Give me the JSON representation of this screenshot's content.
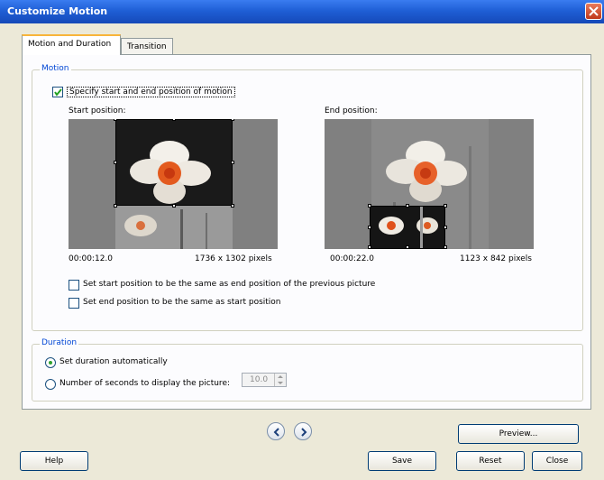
{
  "window": {
    "title": "Customize Motion"
  },
  "tabs": [
    {
      "label": "Motion and Duration"
    },
    {
      "label": "Transition"
    }
  ],
  "motion": {
    "group_label": "Motion",
    "specify_checkbox_label": "Specify start and end position of motion",
    "specify_checked": true,
    "start": {
      "label": "Start position:",
      "time": "00:00:12.0",
      "size": "1736 x 1302 pixels"
    },
    "end": {
      "label": "End position:",
      "time": "00:00:22.0",
      "size": "1123 x 842 pixels"
    },
    "same_as_prev_label": "Set start position to be the same as end position of the previous picture",
    "same_as_prev_checked": false,
    "same_as_start_label": "Set end position to be the same as start position",
    "same_as_start_checked": false
  },
  "duration": {
    "group_label": "Duration",
    "auto_label": "Set duration automatically",
    "auto_selected": true,
    "seconds_label": "Number of seconds to display the picture:",
    "seconds_value": "10.0"
  },
  "buttons": {
    "preview": "Preview...",
    "help": "Help",
    "save": "Save",
    "reset": "Reset",
    "close": "Close"
  },
  "colors": {
    "titlebar": "#1f5fd6",
    "group_label": "#0046d5",
    "dialog_bg": "#ece9d8",
    "radio_dot": "#2fa22f"
  }
}
